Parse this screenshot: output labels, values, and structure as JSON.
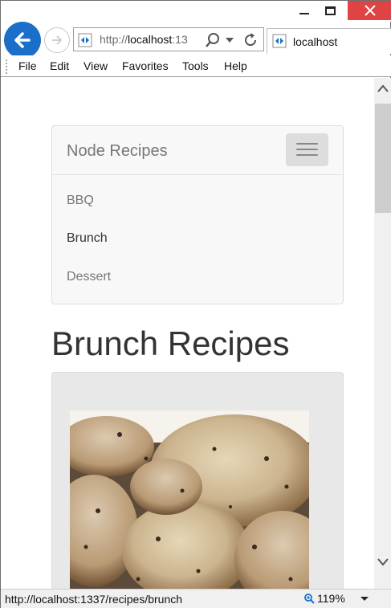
{
  "browser": {
    "address_url_prefix": "http://",
    "address_url_host": "localhost",
    "address_url_rest": ":13",
    "tab_title": "localhost",
    "menu": [
      "File",
      "Edit",
      "View",
      "Favorites",
      "Tools",
      "Help"
    ]
  },
  "page": {
    "brand": "Node Recipes",
    "nav_links": [
      "BBQ",
      "Brunch",
      "Dessert"
    ],
    "active_link": "Brunch",
    "title": "Brunch Recipes"
  },
  "statusbar": {
    "url": "http://localhost:1337/recipes/brunch",
    "zoom": "119%"
  },
  "colors": {
    "back_button": "#1b6fc9",
    "close_button": "#e04343",
    "text_muted": "#777777",
    "text_dark": "#333333"
  },
  "icons": [
    "back-arrow-icon",
    "forward-arrow-icon",
    "page-favicon-icon",
    "search-icon",
    "dropdown-icon",
    "refresh-icon",
    "minimize-icon",
    "maximize-icon",
    "close-icon",
    "hamburger-icon",
    "zoom-magnifier-icon",
    "scroll-up-icon",
    "scroll-down-icon"
  ]
}
